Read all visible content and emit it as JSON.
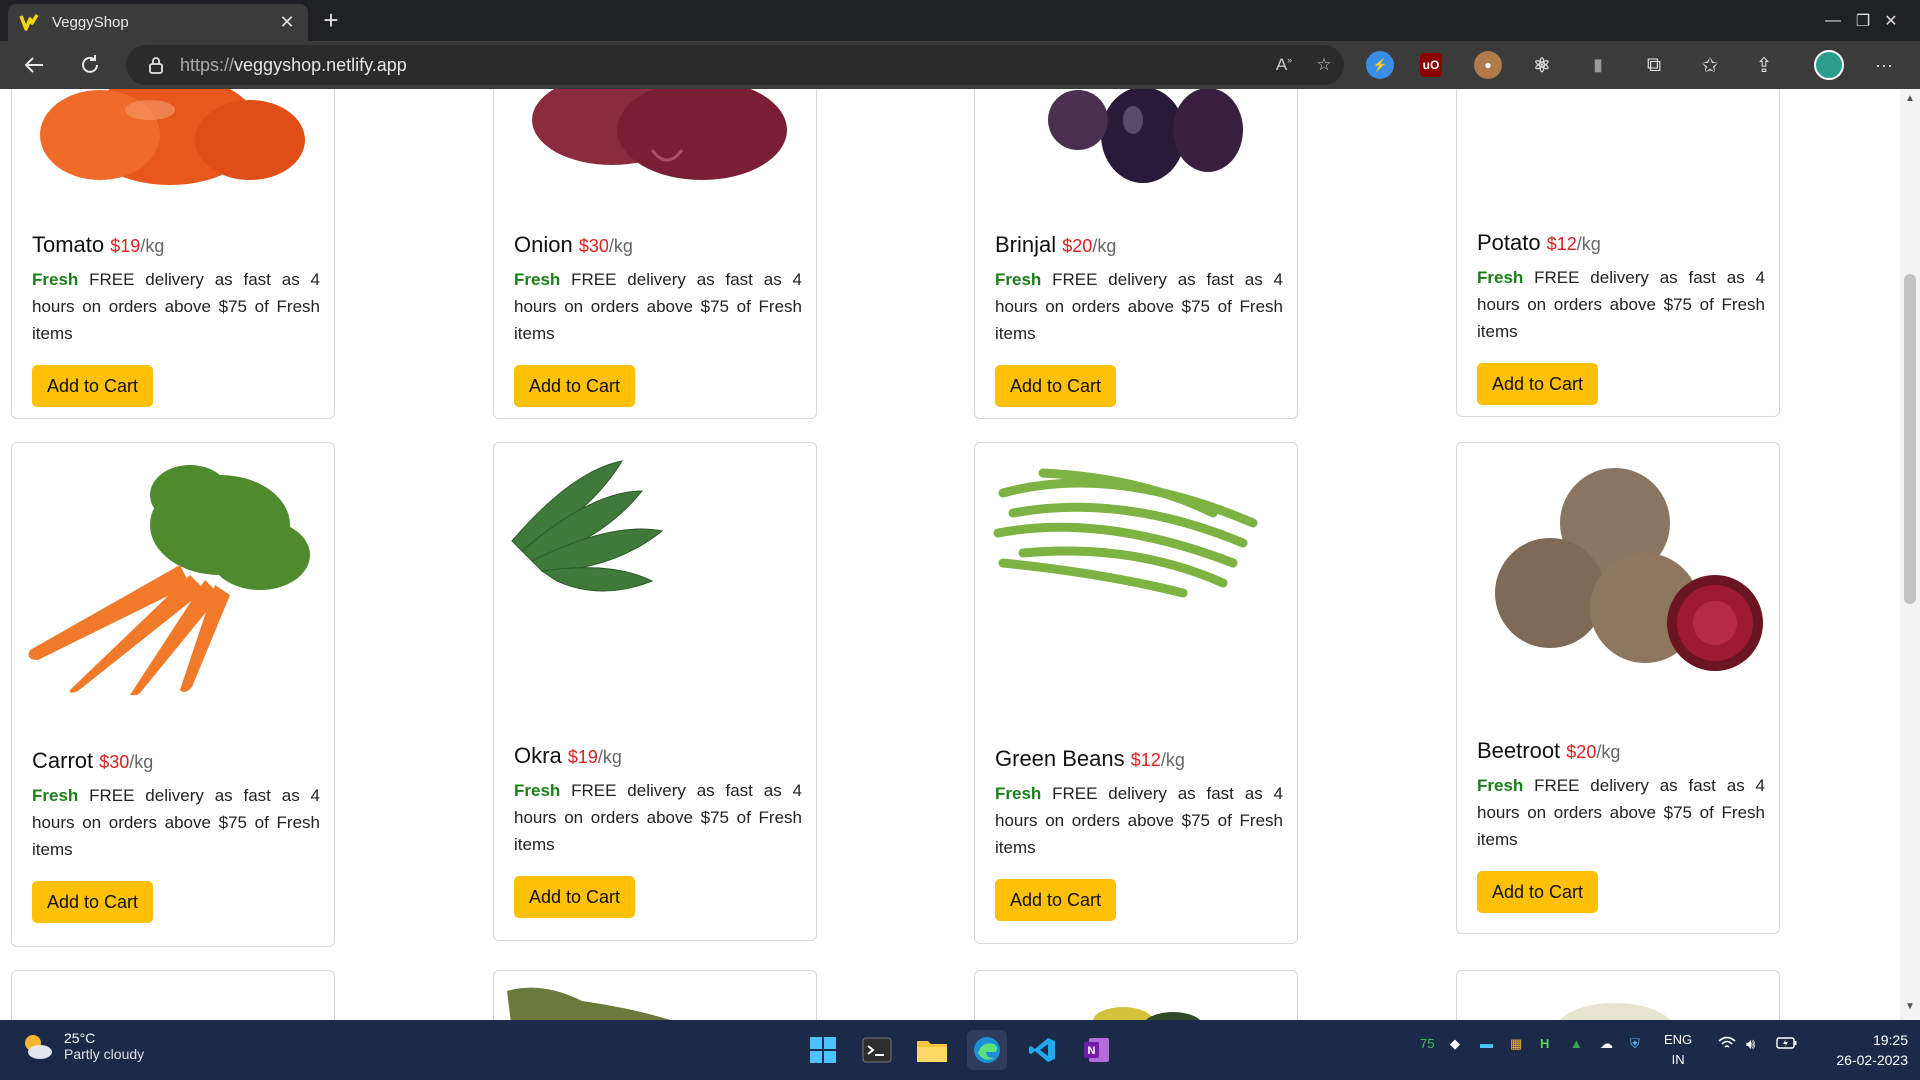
{
  "browser": {
    "tab_title": "VeggyShop",
    "tab_close": "✕",
    "new_tab": "+",
    "url_prefix": "https://",
    "url_host": "veggyshop.netlify.app",
    "window_controls": [
      "—",
      "❐",
      "✕"
    ],
    "profile_initial": "",
    "more_menu": "···"
  },
  "products": [
    {
      "name": "Tomato",
      "price": "$19",
      "unit": "/kg",
      "fresh": "Fresh",
      "desc": " FREE delivery as fast as 4 hours on orders above $75 of Fresh items",
      "button": "Add to Cart",
      "image": "tomato"
    },
    {
      "name": "Onion",
      "price": "$30",
      "unit": "/kg",
      "fresh": "Fresh",
      "desc": " FREE delivery as fast as 4 hours on orders above $75 of Fresh items",
      "button": "Add to Cart",
      "image": "onion"
    },
    {
      "name": "Brinjal",
      "price": "$20",
      "unit": "/kg",
      "fresh": "Fresh",
      "desc": " FREE delivery as fast as 4 hours on orders above $75 of Fresh items",
      "button": "Add to Cart",
      "image": "brinjal"
    },
    {
      "name": "Potato",
      "price": "$12",
      "unit": "/kg",
      "fresh": "Fresh",
      "desc": " FREE delivery as fast as 4 hours on orders above $75 of Fresh items",
      "button": "Add to Cart",
      "image": "potato"
    },
    {
      "name": "Carrot",
      "price": "$30",
      "unit": "/kg",
      "fresh": "Fresh",
      "desc": " FREE delivery as fast as 4 hours on orders above $75 of Fresh items",
      "button": "Add to Cart",
      "image": "carrot"
    },
    {
      "name": "Okra",
      "price": "$19",
      "unit": "/kg",
      "fresh": "Fresh",
      "desc": " FREE delivery as fast as 4 hours on orders above $75 of Fresh items",
      "button": "Add to Cart",
      "image": "okra"
    },
    {
      "name": "Green Beans",
      "price": "$12",
      "unit": "/kg",
      "fresh": "Fresh",
      "desc": " FREE delivery as fast as 4 hours on orders above $75 of Fresh items",
      "button": "Add to Cart",
      "image": "green-beans"
    },
    {
      "name": "Beetroot",
      "price": "$20",
      "unit": "/kg",
      "fresh": "Fresh",
      "desc": " FREE delivery as fast as 4 hours on orders above $75 of Fresh items",
      "button": "Add to Cart",
      "image": "beetroot"
    }
  ],
  "colors": {
    "price": "#e02020",
    "fresh": "#1a7f1a",
    "button": "#ffc107"
  },
  "taskbar": {
    "temperature": "25°C",
    "condition": "Partly cloudy",
    "tray_number": "75",
    "language": "ENG",
    "region": "IN",
    "time": "19:25",
    "date": "26-02-2023"
  }
}
